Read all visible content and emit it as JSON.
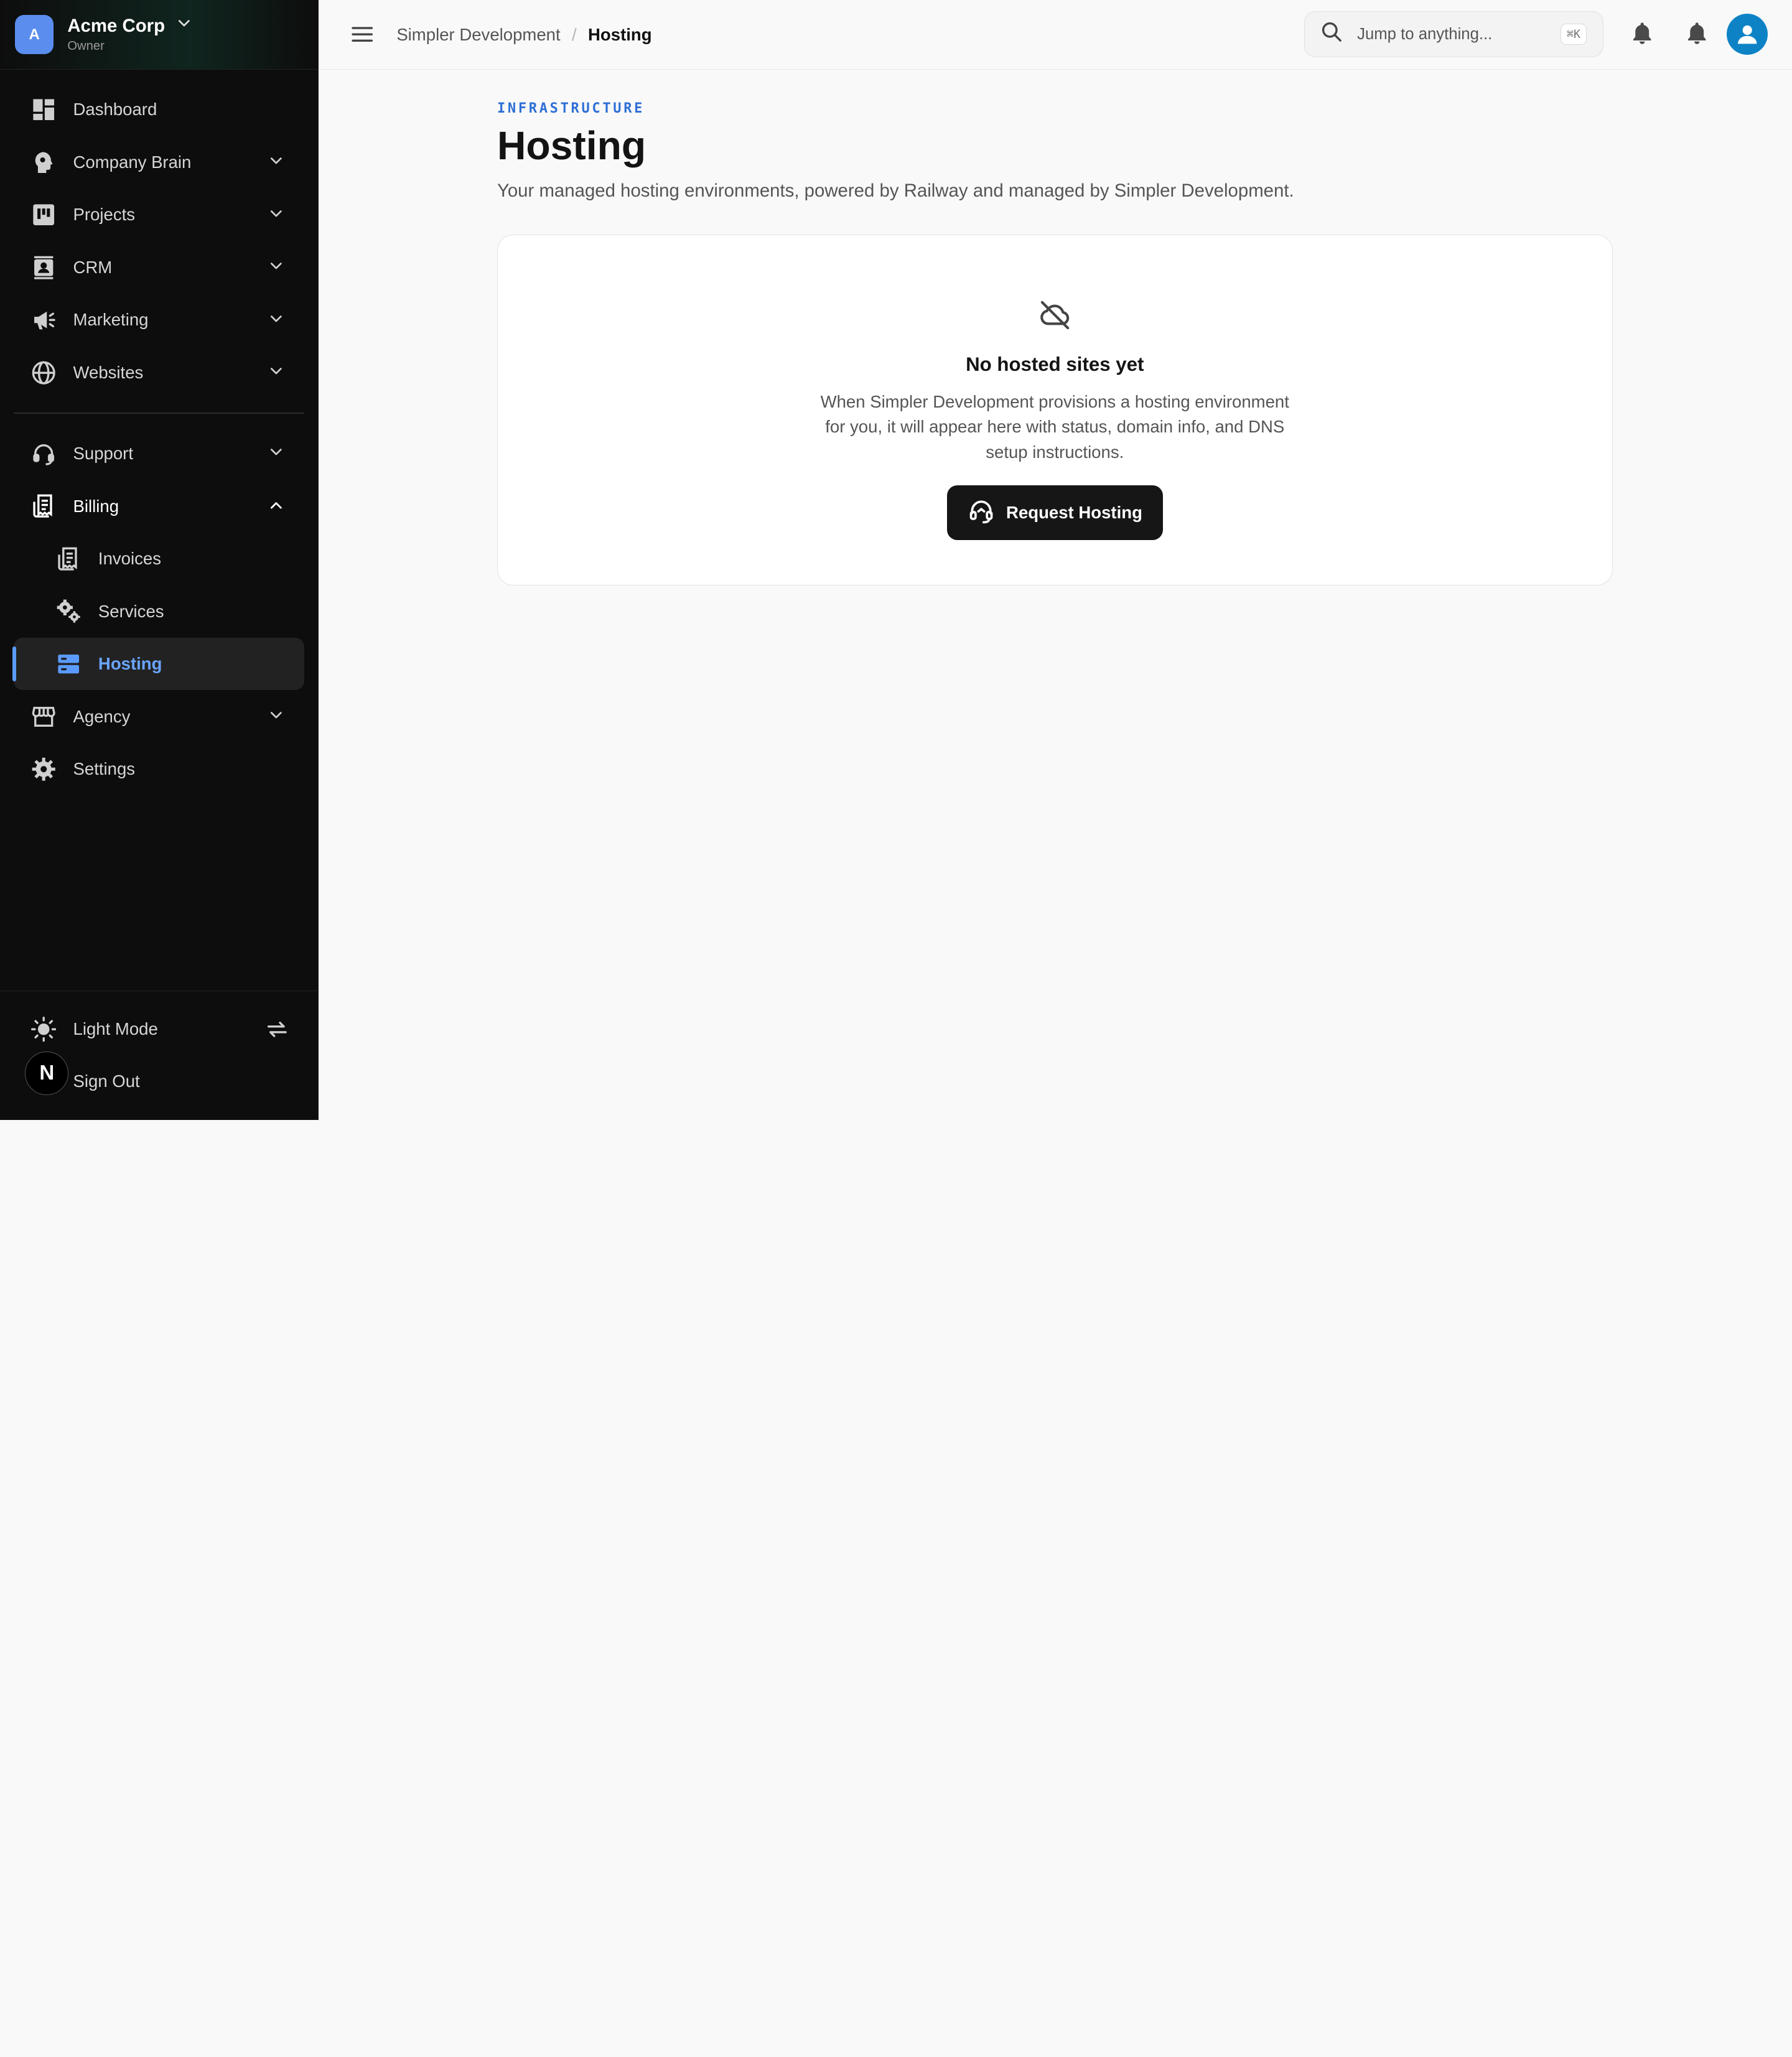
{
  "org": {
    "initial": "A",
    "name": "Acme Corp",
    "role": "Owner"
  },
  "nav": {
    "dashboard": "Dashboard",
    "company_brain": "Company Brain",
    "projects": "Projects",
    "crm": "CRM",
    "marketing": "Marketing",
    "websites": "Websites",
    "support": "Support",
    "billing": "Billing",
    "invoices": "Invoices",
    "services": "Services",
    "hosting": "Hosting",
    "agency": "Agency",
    "settings": "Settings"
  },
  "footer": {
    "light_mode": "Light Mode",
    "sign_out": "Sign Out",
    "badge": "N"
  },
  "breadcrumb": {
    "parent": "Simpler Development",
    "separator": "/",
    "current": "Hosting"
  },
  "search": {
    "placeholder": "Jump to anything...",
    "shortcut": "⌘K"
  },
  "page": {
    "eyebrow": "INFRASTRUCTURE",
    "title": "Hosting",
    "subtitle": "Your managed hosting environments, powered by Railway and managed by Simpler Development."
  },
  "empty_state": {
    "icon": "cloud-off-icon",
    "title": "No hosted sites yet",
    "description": "When Simpler Development provisions a hosting environment for you, it will appear here with status, domain info, and DNS setup instructions.",
    "button": "Request Hosting"
  },
  "colors": {
    "accent": "#5b9bff",
    "eyebrow": "#2f6fd6",
    "sidebar_bg": "#0d0d0d",
    "cta_bg": "#161616",
    "avatar_bg": "#0d83c6"
  }
}
